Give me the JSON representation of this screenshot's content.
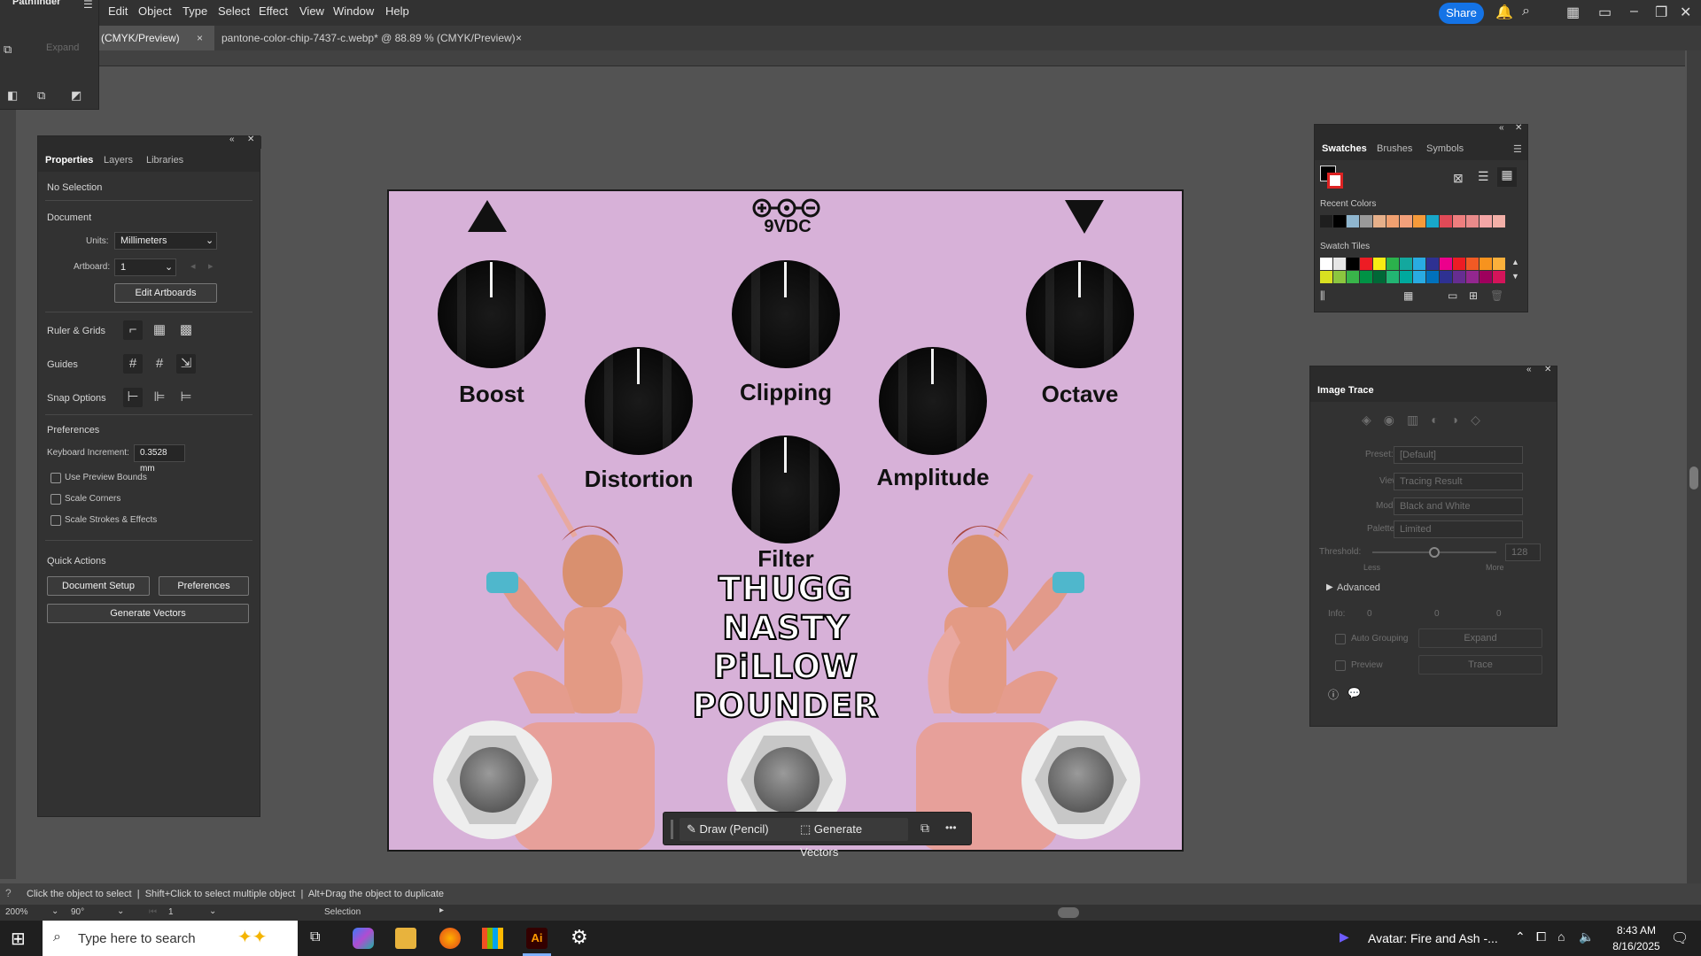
{
  "menubar": {
    "items": [
      "Edit",
      "Object",
      "Type",
      "Select",
      "Effect",
      "View",
      "Window",
      "Help"
    ],
    "share_label": "Share"
  },
  "tabs": [
    {
      "label": "% (CMYK/Preview)",
      "close": "×"
    },
    {
      "label": "pantone-color-chip-7437-c.webp* @ 88.89 % (CMYK/Preview)",
      "close": "×"
    }
  ],
  "pathfinder": {
    "title": "Pathfinder",
    "expand_label": "Expand"
  },
  "properties": {
    "tabs": [
      "Properties",
      "Layers",
      "Libraries"
    ],
    "selection": "No Selection",
    "document_heading": "Document",
    "units_label": "Units:",
    "units_value": "Millimeters",
    "artboard_label": "Artboard:",
    "artboard_value": "1",
    "edit_artboards": "Edit Artboards",
    "ruler_grids": "Ruler & Grids",
    "guides": "Guides",
    "snap_options": "Snap Options",
    "preferences_heading": "Preferences",
    "keyboard_increment_label": "Keyboard Increment:",
    "keyboard_increment_value": "0.3528 mm",
    "use_preview_bounds": "Use Preview Bounds",
    "scale_corners": "Scale Corners",
    "scale_strokes": "Scale Strokes & Effects",
    "quick_actions": "Quick Actions",
    "document_setup": "Document Setup",
    "preferences_btn": "Preferences",
    "generate_vectors": "Generate Vectors"
  },
  "swatches": {
    "tabs": [
      "Swatches",
      "Brushes",
      "Symbols"
    ],
    "recent_colors_label": "Recent Colors",
    "recent_colors": [
      "#1e1e1e",
      "#000000",
      "#8fb6cf",
      "#9a9a9a",
      "#e6b08a",
      "#f0a070",
      "#f2a07a",
      "#f59a3a",
      "#18a7c9",
      "#e04a57",
      "#ee7e7e",
      "#e98a8a",
      "#f4a6a6",
      "#f3b0a8"
    ],
    "swatch_tiles_label": "Swatch Tiles",
    "tiles_row1": [
      "#ffffff",
      "#e6e6e6",
      "#000000",
      "#ed1c24",
      "#f7ec13",
      "#2bb24c",
      "#13a89e",
      "#29abe2",
      "#2e3192",
      "#ec008c",
      "#ed1c24",
      "#f15a24",
      "#f7931e",
      "#fbb03b"
    ],
    "tiles_row2": [
      "#d9e021",
      "#8cc63f",
      "#39b54a",
      "#009245",
      "#006837",
      "#22b573",
      "#00a99d",
      "#29abe2",
      "#0071bc",
      "#2e3192",
      "#662d91",
      "#93278f",
      "#9e005d",
      "#d4145a"
    ]
  },
  "image_trace": {
    "title": "Image Trace",
    "preset_label": "Preset:",
    "preset_value": "[Default]",
    "view_label": "View:",
    "view_value": "Tracing Result",
    "mode_label": "Mode:",
    "mode_value": "Black and White",
    "palette_label": "Palette:",
    "palette_value": "Limited",
    "threshold_label": "Threshold:",
    "threshold_value": "128",
    "less": "Less",
    "more": "More",
    "threshold_level": 0.5,
    "advanced": "Advanced",
    "info_label": "Info:",
    "info_v1": "0",
    "info_v2": "0",
    "info_v3": "0",
    "auto_grouping": "Auto Grouping",
    "expand": "Expand",
    "preview": "Preview",
    "trace": "Trace"
  },
  "artboard": {
    "power_label": "9VDC",
    "knobs": [
      "Boost",
      "Distortion",
      "Clipping",
      "Filter",
      "Amplitude",
      "Octave"
    ],
    "title_lines": [
      "THUGG",
      "NASTY",
      "PiLLOW",
      "POUNDER"
    ]
  },
  "context_toolbar": {
    "draw_label": "Draw (Pencil)",
    "generate_label": "Generate Vectors",
    "more": "•••"
  },
  "status": {
    "hint": "Click the object to select  |  Shift+Click to select multiple object  |  Alt+Drag the object to duplicate",
    "zoom": "200%",
    "rotate": "90°",
    "artboard_nav": "1",
    "tool": "Selection"
  },
  "taskbar": {
    "search_placeholder": "Type here to search",
    "now_playing": "Avatar: Fire and Ash -...",
    "time": "8:43 AM",
    "date": "8/16/2025"
  }
}
